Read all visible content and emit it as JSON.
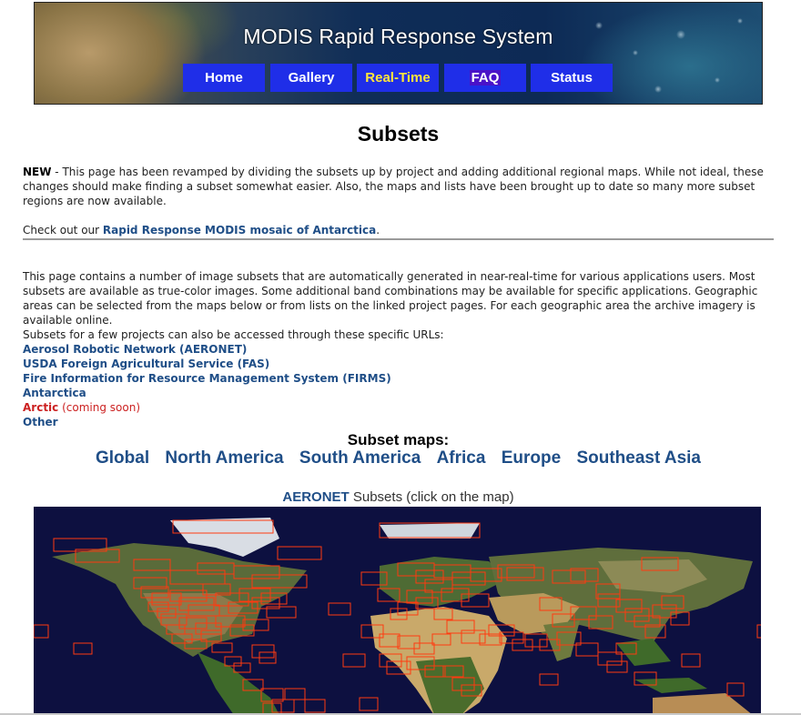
{
  "header": {
    "title": "MODIS Rapid Response System",
    "nav": [
      {
        "label": "Home",
        "active": false
      },
      {
        "label": "Gallery",
        "active": false
      },
      {
        "label": "Real-Time",
        "active": true
      },
      {
        "label": "FAQ",
        "active": false
      },
      {
        "label": "Status",
        "active": false
      }
    ]
  },
  "page_title": "Subsets",
  "notice": {
    "new_label": "NEW",
    "text": " - This page has been revamped by dividing the subsets up by project and adding additional regional maps. While not ideal, these changes should make finding a subset somewhat easier. Also, the maps and lists have been brought up to date so many more subset regions are now available.",
    "checkout_prefix": "Check out our ",
    "checkout_link": "Rapid Response MODIS mosaic of Antarctica",
    "checkout_suffix": "."
  },
  "intro": "This page contains a number of image subsets that are automatically generated in near-real-time for various applications users. Most subsets are available as true-color images. Some additional band combinations may be available for specific applications. Geographic areas can be selected from the maps below or from lists on the linked project pages. For each geographic area the archive imagery is available online.",
  "projects": {
    "prefix": "Subsets for a few projects can also be accessed through these specific URLs:",
    "links": [
      "Aerosol Robotic Network (AERONET)",
      "USDA Foreign Agricultural Service (FAS)",
      "Fire Information for Resource Management System (FIRMS)",
      "Antarctica"
    ],
    "arctic_label": "Arctic",
    "arctic_note": " (coming soon)",
    "other": "Other"
  },
  "subset_maps": {
    "heading": "Subset maps:",
    "regions": [
      "Global",
      "North America",
      "South America",
      "Africa",
      "Europe",
      "Southeast Asia"
    ]
  },
  "aeronet": {
    "link": "AERONET",
    "caption": " Subsets (click on the map)"
  },
  "colors": {
    "nav_button": "#1f2ee8",
    "nav_active_text": "#ffe63a",
    "link": "#1f4e87",
    "subset_box": "#ff3a10",
    "ocean": "#0d1040"
  }
}
